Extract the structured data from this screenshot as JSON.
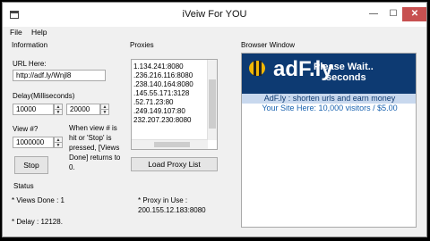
{
  "window": {
    "title": "iVeiw For YOU",
    "min_glyph": "—",
    "max_glyph": "☐",
    "close_glyph": "✕"
  },
  "menu": [
    "File",
    "Help"
  ],
  "information": {
    "heading": "Information",
    "url_label": "URL Here:",
    "url_value": "http://adf.ly/Wnjl8",
    "delay_label": "Delay(Milliseconds)",
    "delay_min": "10000",
    "delay_max": "20000",
    "view_label": "View #?",
    "view_value": "1000000",
    "note": "When view # is hit or 'Stop' is pressed, [Views Done] returns to 0.",
    "stop_button": "Stop"
  },
  "proxies": {
    "heading": "Proxies",
    "items": [
      "1.134.241:8080",
      ".236.216.116:8080",
      ".238.140.164:8080",
      ".145.55.171:3128",
      ".52.71.23:80",
      ".249.149.107:80",
      "232.207.230:8080"
    ],
    "load_button": "Load Proxy List"
  },
  "status": {
    "heading": "Status",
    "views_done": "* Views Done :  1",
    "delay": "* Delay :  12128.",
    "proxy_label": "* Proxy in Use :",
    "proxy_value": "200.155.12.183:8080"
  },
  "browser": {
    "heading": "Browser Window",
    "logo": "adF.ly",
    "wait_line1": "Please Wait..",
    "wait_line2": "seconds",
    "tagline": "AdF.ly : shorten urls and earn money",
    "your_site": "Your Site Here: 10,000 visitors / $5.00"
  }
}
